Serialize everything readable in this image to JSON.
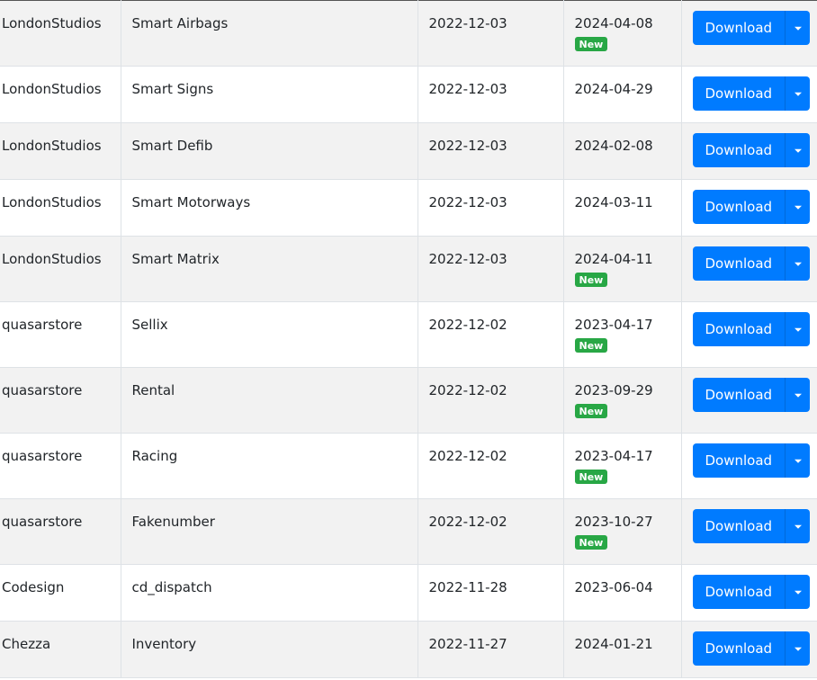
{
  "accent_color": "#007bff",
  "badge_color": "#28a745",
  "download_label": "Download",
  "new_label": "New",
  "rows": [
    {
      "author": "LondonStudios",
      "name": "Smart Airbags",
      "created": "2022-12-03",
      "updated": "2024-04-08",
      "is_new": true
    },
    {
      "author": "LondonStudios",
      "name": "Smart Signs",
      "created": "2022-12-03",
      "updated": "2024-04-29",
      "is_new": false
    },
    {
      "author": "LondonStudios",
      "name": "Smart Defib",
      "created": "2022-12-03",
      "updated": "2024-02-08",
      "is_new": false
    },
    {
      "author": "LondonStudios",
      "name": "Smart Motorways",
      "created": "2022-12-03",
      "updated": "2024-03-11",
      "is_new": false
    },
    {
      "author": "LondonStudios",
      "name": "Smart Matrix",
      "created": "2022-12-03",
      "updated": "2024-04-11",
      "is_new": true
    },
    {
      "author": "quasarstore",
      "name": "Sellix",
      "created": "2022-12-02",
      "updated": "2023-04-17",
      "is_new": true
    },
    {
      "author": "quasarstore",
      "name": "Rental",
      "created": "2022-12-02",
      "updated": "2023-09-29",
      "is_new": true
    },
    {
      "author": "quasarstore",
      "name": "Racing",
      "created": "2022-12-02",
      "updated": "2023-04-17",
      "is_new": true
    },
    {
      "author": "quasarstore",
      "name": "Fakenumber",
      "created": "2022-12-02",
      "updated": "2023-10-27",
      "is_new": true
    },
    {
      "author": "Codesign",
      "name": "cd_dispatch",
      "created": "2022-11-28",
      "updated": "2023-06-04",
      "is_new": false
    },
    {
      "author": "Chezza",
      "name": "Inventory",
      "created": "2022-11-27",
      "updated": "2024-01-21",
      "is_new": false
    }
  ]
}
